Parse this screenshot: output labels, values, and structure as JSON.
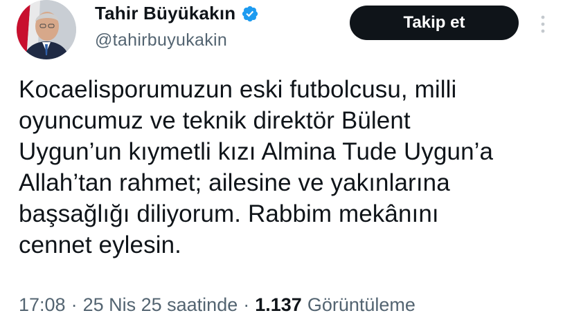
{
  "author": {
    "display_name": "Tahir Büyükakın",
    "handle": "@tahirbuyukakin",
    "verified_icon": "verified-badge-icon",
    "verified_color": "#1d9bf0"
  },
  "follow_button": {
    "label": "Takip et",
    "background": "#0f1419"
  },
  "menu": {
    "icon": "more-vertical-icon"
  },
  "tweet": {
    "text": "Kocaelisporumuzun eski futbolcusu, milli\noyuncumuz ve teknik direktör Bülent\nUygun’un kıymetli kızı Almina Tude Uygun’a\nAllah’tan rahmet; ailesine ve yakınlarına\nbaşsağlığı diliyorum. Rabbim mekânını\ncennet eylesin."
  },
  "meta": {
    "time": "17:08",
    "separator": "·",
    "date": "25 Nis 25 saatinde",
    "views_count": "1.137",
    "views_label": "Görüntüleme"
  }
}
